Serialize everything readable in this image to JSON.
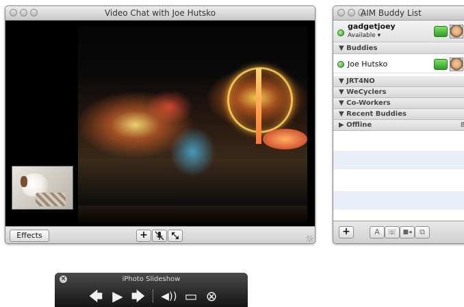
{
  "video_window": {
    "title": "Video Chat with Joe Hutsko",
    "effects_label": "Effects",
    "toolbar": {
      "add_icon": "+",
      "mute_icon": "microphone-mute-icon",
      "fullscreen_icon": "expand-arrows-icon"
    }
  },
  "buddy_window": {
    "title": "AIM Buddy List",
    "me": {
      "name": "gadgetjoey",
      "status": "Available ▾"
    },
    "groups": [
      {
        "label": "▼ Buddies"
      },
      {
        "label": "▼ JRT4NO"
      },
      {
        "label": "▼ WeCyclers"
      },
      {
        "label": "▼ Co-Workers"
      },
      {
        "label": "▼ Recent Buddies"
      },
      {
        "label": "▶ Offline",
        "count": "8"
      }
    ],
    "buddy": {
      "name": "Joe Hutsko"
    },
    "footer": {
      "add": "+",
      "text": "A",
      "phone": "☏",
      "video": "■◂",
      "share": "⧉"
    }
  },
  "slideshow": {
    "title": "iPhoto Slideshow",
    "close": "×",
    "controls": {
      "prev": "🡄",
      "play": "▶",
      "next": "🡆",
      "volume": "◀))",
      "screen": "▭",
      "exit": "⊗"
    }
  }
}
